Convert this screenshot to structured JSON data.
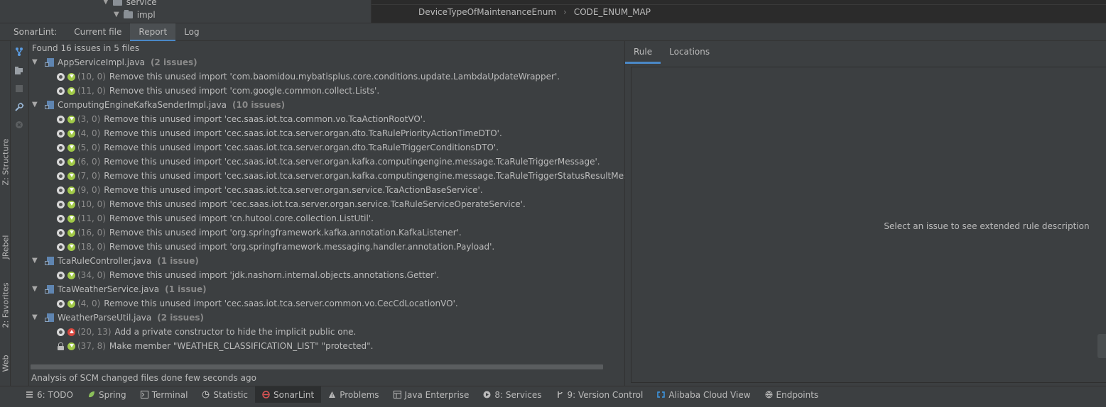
{
  "project_tree": {
    "items": [
      {
        "label": "service"
      },
      {
        "label": "impl"
      }
    ]
  },
  "editor": {
    "breadcrumbs": [
      "DeviceTypeOfMaintenanceEnum",
      "CODE_ENUM_MAP"
    ]
  },
  "sonarlint": {
    "title": "SonarLint:",
    "tabs": [
      {
        "label": "Current file"
      },
      {
        "label": "Report",
        "active": true
      },
      {
        "label": "Log"
      }
    ],
    "summary": "Found 16 issues in 5 files",
    "files": [
      {
        "name": "AppServiceImpl.java",
        "count": "(2 issues)",
        "issues": [
          {
            "loc": "(10, 0)",
            "severity": "minor",
            "type": "code-smell",
            "message": "Remove this unused import 'com.baomidou.mybatisplus.core.conditions.update.LambdaUpdateWrapper'."
          },
          {
            "loc": "(11, 0)",
            "severity": "minor",
            "type": "code-smell",
            "message": "Remove this unused import 'com.google.common.collect.Lists'."
          }
        ]
      },
      {
        "name": "ComputingEngineKafkaSenderImpl.java",
        "count": "(10 issues)",
        "issues": [
          {
            "loc": "(3, 0)",
            "severity": "minor",
            "type": "code-smell",
            "message": "Remove this unused import 'cec.saas.iot.tca.common.vo.TcaActionRootVO'."
          },
          {
            "loc": "(4, 0)",
            "severity": "minor",
            "type": "code-smell",
            "message": "Remove this unused import 'cec.saas.iot.tca.server.organ.dto.TcaRulePriorityActionTimeDTO'."
          },
          {
            "loc": "(5, 0)",
            "severity": "minor",
            "type": "code-smell",
            "message": "Remove this unused import 'cec.saas.iot.tca.server.organ.dto.TcaRuleTriggerConditionsDTO'."
          },
          {
            "loc": "(6, 0)",
            "severity": "minor",
            "type": "code-smell",
            "message": "Remove this unused import 'cec.saas.iot.tca.server.organ.kafka.computingengine.message.TcaRuleTriggerMessage'."
          },
          {
            "loc": "(7, 0)",
            "severity": "minor",
            "type": "code-smell",
            "message": "Remove this unused import 'cec.saas.iot.tca.server.organ.kafka.computingengine.message.TcaRuleTriggerStatusResultMessag"
          },
          {
            "loc": "(9, 0)",
            "severity": "minor",
            "type": "code-smell",
            "message": "Remove this unused import 'cec.saas.iot.tca.server.organ.service.TcaActionBaseService'."
          },
          {
            "loc": "(10, 0)",
            "severity": "minor",
            "type": "code-smell",
            "message": "Remove this unused import 'cec.saas.iot.tca.server.organ.service.TcaRuleServiceOperateService'."
          },
          {
            "loc": "(11, 0)",
            "severity": "minor",
            "type": "code-smell",
            "message": "Remove this unused import 'cn.hutool.core.collection.ListUtil'."
          },
          {
            "loc": "(16, 0)",
            "severity": "minor",
            "type": "code-smell",
            "message": "Remove this unused import 'org.springframework.kafka.annotation.KafkaListener'."
          },
          {
            "loc": "(18, 0)",
            "severity": "minor",
            "type": "code-smell",
            "message": "Remove this unused import 'org.springframework.messaging.handler.annotation.Payload'."
          }
        ]
      },
      {
        "name": "TcaRuleController.java",
        "count": "(1 issue)",
        "issues": [
          {
            "loc": "(34, 0)",
            "severity": "minor",
            "type": "code-smell",
            "message": "Remove this unused import 'jdk.nashorn.internal.objects.annotations.Getter'."
          }
        ]
      },
      {
        "name": "TcaWeatherService.java",
        "count": "(1 issue)",
        "issues": [
          {
            "loc": "(4, 0)",
            "severity": "minor",
            "type": "code-smell",
            "message": "Remove this unused import 'cec.saas.iot.tca.server.common.vo.CecCdLocationVO'."
          }
        ]
      },
      {
        "name": "WeatherParseUtil.java",
        "count": "(2 issues)",
        "issues": [
          {
            "loc": "(20, 13)",
            "severity": "major",
            "type": "code-smell",
            "message": "Add a private constructor to hide the implicit public one."
          },
          {
            "loc": "(37, 8)",
            "severity": "minor",
            "type": "vulnerability",
            "message": "Make member \"WEATHER_CLASSIFICATION_LIST\" \"protected\"."
          }
        ]
      }
    ],
    "status": "Analysis of SCM changed files done few seconds ago",
    "rule_tabs": [
      {
        "label": "Rule",
        "active": true
      },
      {
        "label": "Locations"
      }
    ],
    "rule_placeholder": "Select an issue to see extended rule description"
  },
  "side_labels": [
    "Web",
    "2: Favorites",
    "JRebel",
    "Z: Structure"
  ],
  "bottom_tools": [
    {
      "label": "6: TODO",
      "icon": "todo-icon"
    },
    {
      "label": "Spring",
      "icon": "spring-icon"
    },
    {
      "label": "Terminal",
      "icon": "terminal-icon"
    },
    {
      "label": "Statistic",
      "icon": "statistic-icon"
    },
    {
      "label": "SonarLint",
      "icon": "sonarlint-icon",
      "active": true
    },
    {
      "label": "Problems",
      "icon": "problems-icon"
    },
    {
      "label": "Java Enterprise",
      "icon": "java-enterprise-icon"
    },
    {
      "label": "8: Services",
      "icon": "services-icon"
    },
    {
      "label": "9: Version Control",
      "icon": "version-control-icon"
    },
    {
      "label": "Alibaba Cloud View",
      "icon": "alibaba-cloud-icon"
    },
    {
      "label": "Endpoints",
      "icon": "endpoints-icon"
    }
  ],
  "colors": {
    "background": "#3c3f41",
    "editor": "#2b2b2b",
    "accent": "#4a88c7",
    "minor_severity": "#a1c948",
    "major_severity": "#d8473f",
    "sonarlint_red": "#e05555"
  }
}
